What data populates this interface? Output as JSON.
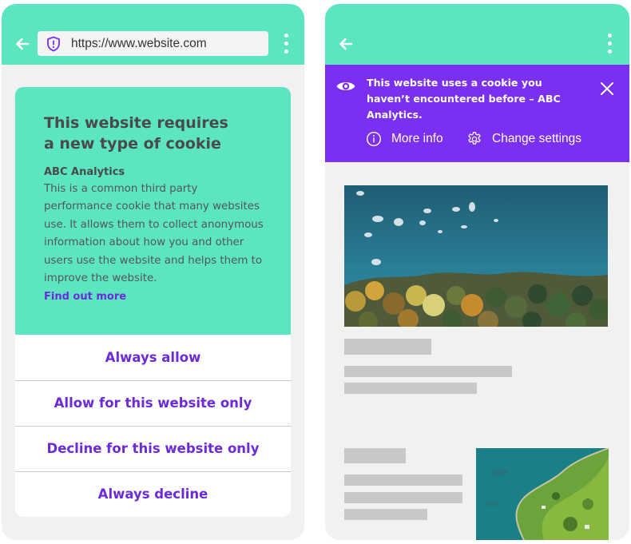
{
  "left_phone": {
    "url": "https://www.website.com",
    "card": {
      "title": "This website requires a new type of cookie",
      "cookie_name": "ABC Analytics",
      "description": "This is a common third party performance cookie that many websites use. It allows them to collect anonymous information about how you and other users use the website and helps them to improve the website.",
      "link": "Find out more"
    },
    "options": [
      "Always allow",
      "Allow for this website only",
      "Decline for this website only",
      "Always decline"
    ]
  },
  "right_phone": {
    "banner": {
      "message": "This website uses a cookie you haven’t encountered before – ABC Analytics.",
      "more_info": "More info",
      "change_settings": "Change settings"
    }
  },
  "colors": {
    "mint": "#5ce5c1",
    "purple_banner": "#7b2ff0",
    "purple_text": "#6b2bd9",
    "placeholder_gray": "#c8c8c8",
    "screen_bg": "#f1f1f1"
  },
  "icons": [
    "back-arrow-icon",
    "shield-icon",
    "more-vertical-icon",
    "eye-icon",
    "close-icon",
    "info-icon",
    "settings-gear-icon"
  ]
}
